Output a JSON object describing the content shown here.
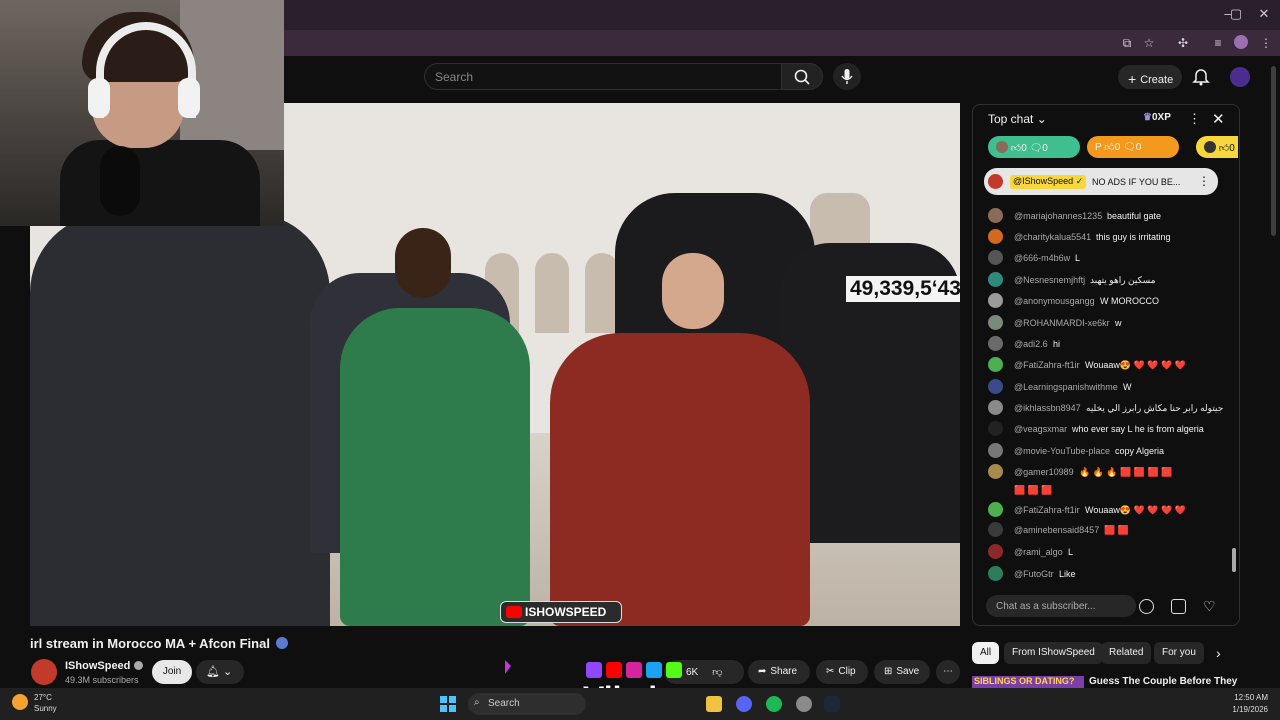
{
  "browser": {
    "window_controls": [
      "–",
      "▢",
      "✕"
    ]
  },
  "header": {
    "search_placeholder": "Search",
    "create_label": "Create"
  },
  "video": {
    "viewer_count": "49,339,5ʻ43",
    "watermark": "ISHOWSPEED"
  },
  "info": {
    "title": "irl stream in Morocco MA + Afcon Final",
    "channel": "IShowSpeed",
    "subscribers": "49.3M subscribers",
    "join": "Join",
    "likes": "6K",
    "share": "Share",
    "clip": "Clip",
    "save": "Save"
  },
  "overlay": {
    "brand": "Vibzlo"
  },
  "chat": {
    "header": "Top chat",
    "xp": "0XP",
    "pills": [
      {
        "likes": "0",
        "comments": "0"
      },
      {
        "letter": "P",
        "likes": "0",
        "comments": "0"
      },
      {
        "likes": "0"
      }
    ],
    "pinned": {
      "author": "@IShowSpeed",
      "text": "NO ADS IF YOU BE..."
    },
    "messages": [
      {
        "author": "@mariajohannes1235",
        "text": "beautiful gate",
        "color": "#8a6b5a"
      },
      {
        "author": "@charitykalua5541",
        "text": "this guy is irritating",
        "color": "#d2691e"
      },
      {
        "author": "@666-m4b6w",
        "text": "L",
        "color": "#555555"
      },
      {
        "author": "@Nesnesnemjhftj",
        "text": "مسكين راهو يتهبد",
        "color": "#2e8b7a"
      },
      {
        "author": "@anonymousgangg",
        "text": "W MOROCCO",
        "color": "#9a9a9a"
      },
      {
        "author": "@ROHANMARDI-xe6kr",
        "text": "w",
        "color": "#7a8a7a"
      },
      {
        "author": "@adi2.6",
        "text": "hi",
        "color": "#6a6a6a"
      },
      {
        "author": "@FatiZahra-ft1ir",
        "text": "Wouaaw😍 ❤️ ❤️ ❤️ ❤️",
        "color": "#4caf50"
      },
      {
        "author": "@Learningspanishwithme",
        "text": "W",
        "color": "#3a4a8a"
      },
      {
        "author": "@ikhlassbn8947",
        "text": "جيتوله رابر حنا مكاش رابرز الي يخليه",
        "color": "#8a8a8a"
      },
      {
        "author": "@veagsxmar",
        "text": "who ever say L he is from algeria",
        "color": "#222222"
      },
      {
        "author": "@movie-YouTube-place",
        "text": "copy Algeria",
        "color": "#777777"
      },
      {
        "author": "@gamer10989",
        "text": "🔥 🔥 🔥 🟥 🟥 🟥 🟥",
        "color": "#a58a4a"
      },
      {
        "author": "",
        "text": "🟥 🟥 🟥",
        "color": ""
      },
      {
        "author": "@FatiZahra-ft1ir",
        "text": "Wouaaw😍 ❤️ ❤️ ❤️ ❤️",
        "color": "#4caf50"
      },
      {
        "author": "@aminebensaid8457",
        "text": "🟥 🟥",
        "color": "#3a3a3a"
      },
      {
        "author": "@rami_algo",
        "text": "L",
        "color": "#8a2a2a"
      },
      {
        "author": "@FutoGtr",
        "text": "Like",
        "color": "#2e7d5a"
      }
    ],
    "input_placeholder": "Chat as a subscriber..."
  },
  "chips": [
    "All",
    "From IShowSpeed",
    "Related",
    "For you"
  ],
  "recommendation": {
    "thumb_text": "SIBLINGS OR DATING?",
    "title": "Guess The Couple Before They"
  },
  "taskbar": {
    "temperature": "27°C",
    "condition": "Sunny",
    "search": "Search",
    "time": "12:50 AM",
    "date": "1/19/2026"
  },
  "colors": {
    "background": "#0f0f0f",
    "chrome": "#2a1f2b",
    "pill_green": "#3fbf8f",
    "pill_orange": "#f39a1e",
    "pill_yellow": "#f7d73b",
    "youtube_red": "#ff0000"
  }
}
